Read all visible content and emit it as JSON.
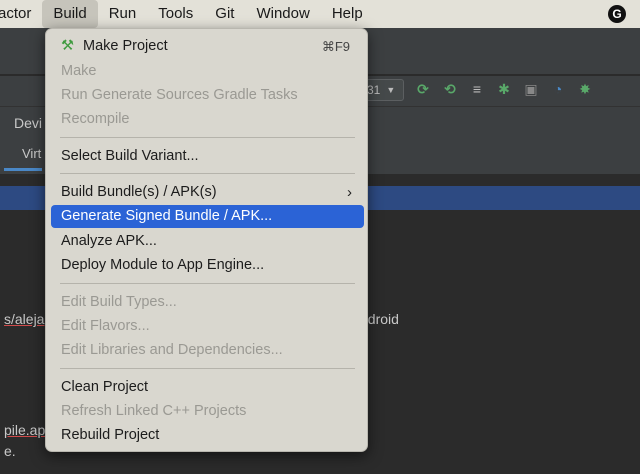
{
  "menubar": {
    "items": [
      "actor",
      "Build",
      "Run",
      "Tools",
      "Git",
      "Window",
      "Help"
    ],
    "active": "Build",
    "grammarly_label": "G"
  },
  "background": {
    "tab_label": "Devi",
    "subtab_label": "Virt",
    "run_config": "31",
    "path_prefix": "s/aleja",
    "path_suffix": "ndroid",
    "file_line1": "pile.ap",
    "file_line2": "e."
  },
  "toolbar_icons": [
    "rerun-icon",
    "apply-changes-icon",
    "logcat-icon",
    "debug-icon",
    "attach-icon",
    "profile-icon",
    "debug-bug-icon"
  ],
  "build_menu": {
    "make_project": {
      "label": "Make Project",
      "shortcut": "⌘F9"
    },
    "make": "Make",
    "run_generate_sources": "Run Generate Sources Gradle Tasks",
    "recompile": "Recompile",
    "select_build_variant": "Select Build Variant...",
    "build_bundle_apk": "Build Bundle(s) / APK(s)",
    "generate_signed": "Generate Signed Bundle / APK...",
    "analyze_apk": "Analyze APK...",
    "deploy_module": "Deploy Module to App Engine...",
    "edit_build_types": "Edit Build Types...",
    "edit_flavors": "Edit Flavors...",
    "edit_libraries": "Edit Libraries and Dependencies...",
    "clean_project": "Clean Project",
    "refresh_linked": "Refresh Linked C++ Projects",
    "rebuild_project": "Rebuild Project"
  }
}
